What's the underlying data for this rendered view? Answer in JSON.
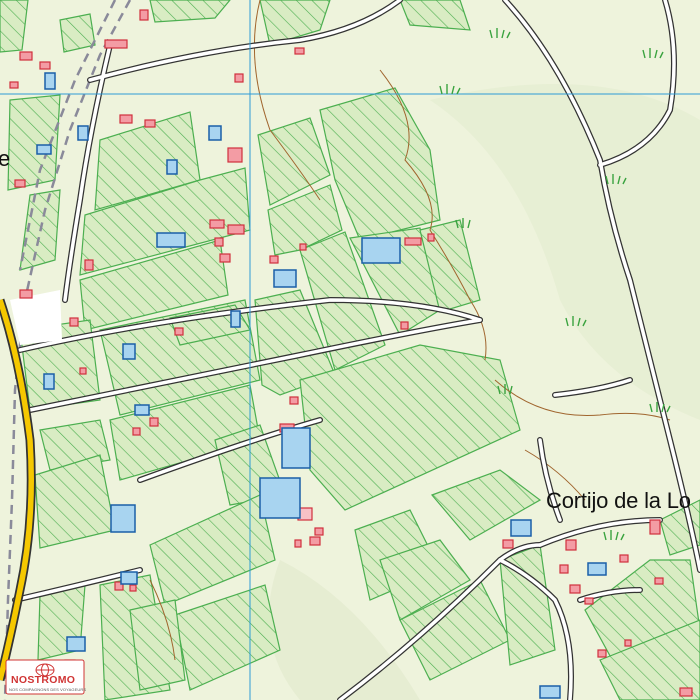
{
  "map": {
    "place_labels": {
      "cortijo": "Cortijo de la Lo",
      "partial_left": "e"
    },
    "colors": {
      "background": "#eef3dc",
      "field_fill": "#d9ecc3",
      "hatch": "#4caf50",
      "road_fill": "#ffffff",
      "road_casing": "#333333",
      "main_road": "#f5c800",
      "building_red": "#e2505a",
      "building_blue": "#a8d4f0",
      "grid_line": "#2d9bd6",
      "contour": "#a0652e",
      "track_dash": "#8a8a9a"
    },
    "icons": [
      "grass-tuft-icon",
      "logo-globe-icon"
    ]
  },
  "logo": {
    "name": "NOSTROMO",
    "tagline": "NOS COMPAGNONS DES VOYAGEURS"
  }
}
